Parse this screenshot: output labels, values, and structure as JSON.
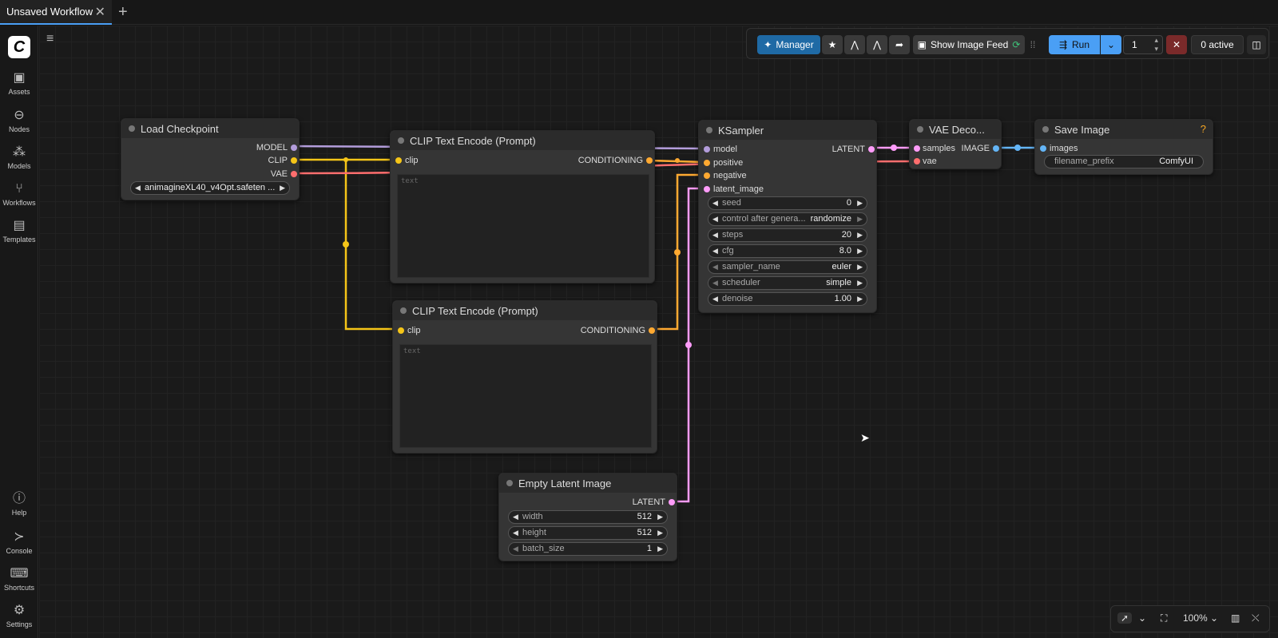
{
  "tabs": [
    {
      "label": "Unsaved Workflow"
    }
  ],
  "sidebar": {
    "items": [
      {
        "label": "Assets",
        "icon": "image-icon"
      },
      {
        "label": "Nodes",
        "icon": "node-icon"
      },
      {
        "label": "Models",
        "icon": "models-icon"
      },
      {
        "label": "Workflows",
        "icon": "workflow-icon"
      },
      {
        "label": "Templates",
        "icon": "templates-icon"
      }
    ],
    "bottom": [
      {
        "label": "Help",
        "icon": "help-icon"
      },
      {
        "label": "Console",
        "icon": "console-icon"
      },
      {
        "label": "Shortcuts",
        "icon": "keyboard-icon"
      },
      {
        "label": "Settings",
        "icon": "gear-icon"
      }
    ]
  },
  "toolbar": {
    "manager": "Manager",
    "show_image_feed": "Show Image Feed",
    "run": "Run",
    "queue_count": "1",
    "active": "0 active"
  },
  "nodes": {
    "load_checkpoint": {
      "title": "Load Checkpoint",
      "outputs": [
        "MODEL",
        "CLIP",
        "VAE"
      ],
      "ckpt": "animagineXL40_v4Opt.safeten ..."
    },
    "clip_pos": {
      "title": "CLIP Text Encode (Prompt)",
      "input": "clip",
      "output": "CONDITIONING",
      "placeholder": "text"
    },
    "clip_neg": {
      "title": "CLIP Text Encode (Prompt)",
      "input": "clip",
      "output": "CONDITIONING",
      "placeholder": "text"
    },
    "ksampler": {
      "title": "KSampler",
      "inputs": [
        "model",
        "positive",
        "negative",
        "latent_image"
      ],
      "output": "LATENT",
      "widgets": [
        {
          "label": "seed",
          "value": "0"
        },
        {
          "label": "control after genera...",
          "value": "randomize"
        },
        {
          "label": "steps",
          "value": "20"
        },
        {
          "label": "cfg",
          "value": "8.0"
        },
        {
          "label": "sampler_name",
          "value": "euler"
        },
        {
          "label": "scheduler",
          "value": "simple"
        },
        {
          "label": "denoise",
          "value": "1.00"
        }
      ]
    },
    "vae_decode": {
      "title": "VAE Deco...",
      "inputs": [
        "samples",
        "vae"
      ],
      "output": "IMAGE"
    },
    "save_image": {
      "title": "Save Image",
      "input": "images",
      "prefix_label": "filename_prefix",
      "prefix_value": "ComfyUI",
      "help": "?"
    },
    "empty_latent": {
      "title": "Empty Latent Image",
      "output": "LATENT",
      "widgets": [
        {
          "label": "width",
          "value": "512"
        },
        {
          "label": "height",
          "value": "512"
        },
        {
          "label": "batch_size",
          "value": "1"
        }
      ]
    }
  },
  "bottombar": {
    "zoom": "100%"
  },
  "colors": {
    "model": "#b39ddb",
    "clip": "#f5c518",
    "vae": "#ff6e6e",
    "conditioning": "#ffa931",
    "latent": "#ff9cf9",
    "image": "#64b5f6",
    "accent": "#4a9ff5"
  }
}
